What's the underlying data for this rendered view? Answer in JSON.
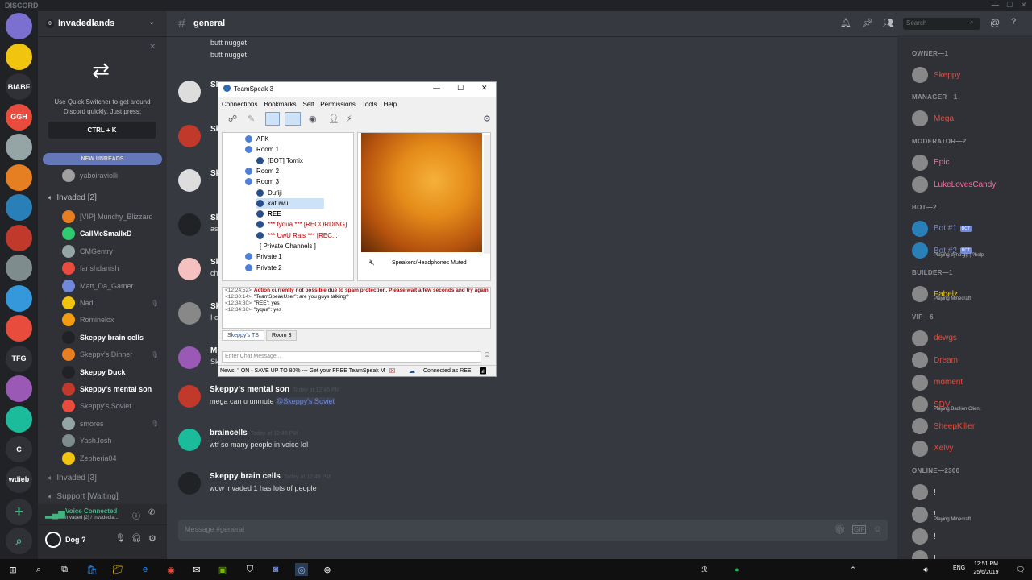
{
  "app_title": "DISCORD",
  "window_controls": [
    "—",
    "☐",
    "✕"
  ],
  "guilds": [
    {
      "label": "",
      "color": "#7b6fd0"
    },
    {
      "label": "",
      "color": "#f1c40f"
    },
    {
      "label": "BIABF",
      "color": "#2f3136"
    },
    {
      "label": "GGH",
      "color": "#e74c3c"
    },
    {
      "label": "",
      "color": "#95a5a6"
    },
    {
      "label": "",
      "color": "#e67e22"
    },
    {
      "label": "",
      "color": "#2980b9"
    },
    {
      "label": "",
      "color": "#c0392b"
    },
    {
      "label": "",
      "color": "#7f8c8d"
    },
    {
      "label": "",
      "color": "#3498db"
    },
    {
      "label": "",
      "color": "#e74c3c"
    },
    {
      "label": "TFG",
      "color": "#2f3136"
    },
    {
      "label": "",
      "color": "#9b59b6"
    },
    {
      "label": "",
      "color": "#1abc9c"
    },
    {
      "label": "C",
      "color": "#2f3136"
    },
    {
      "label": "wdieb",
      "color": "#2f3136"
    }
  ],
  "server": {
    "name": "Invadedlands",
    "badge": "0"
  },
  "quick_switcher": {
    "text": "Use Quick Switcher to get around Discord quickly. Just press:",
    "shortcut": "CTRL + K"
  },
  "new_unreads": "NEW UNREADS",
  "top_voice_user": "yaboiraviolli",
  "voice_channel_1": "Invaded [2]",
  "voice_users": [
    {
      "name": "[VIP] Munchy_Blizzard",
      "color": "#e67e22",
      "muted": false,
      "bold": false
    },
    {
      "name": "CallMeSmallxD",
      "color": "#2ecc71",
      "muted": false,
      "bold": true
    },
    {
      "name": "CMGentry",
      "color": "#95a5a6",
      "muted": false,
      "bold": false
    },
    {
      "name": "farishdanish",
      "color": "#e74c3c",
      "muted": false,
      "bold": false
    },
    {
      "name": "Matt_Da_Gamer",
      "color": "#7289da",
      "muted": false,
      "bold": false
    },
    {
      "name": "Nadi",
      "color": "#f1c40f",
      "muted": true,
      "bold": false
    },
    {
      "name": "Rominelox",
      "color": "#f39c12",
      "muted": false,
      "bold": false
    },
    {
      "name": "Skeppy brain cells",
      "color": "#202225",
      "muted": false,
      "bold": true
    },
    {
      "name": "Skeppy's Dinner",
      "color": "#e67e22",
      "muted": true,
      "bold": false
    },
    {
      "name": "Skeppy Duck",
      "color": "#202225",
      "muted": false,
      "bold": true
    },
    {
      "name": "Skeppy's mental son",
      "color": "#c0392b",
      "muted": false,
      "bold": true
    },
    {
      "name": "Skeppy's Soviet",
      "color": "#e74c3c",
      "muted": false,
      "bold": false
    },
    {
      "name": "smores",
      "color": "#95a5a6",
      "muted": true,
      "bold": false
    },
    {
      "name": "Yash.Iosh",
      "color": "#7f8c8d",
      "muted": false,
      "bold": false
    },
    {
      "name": "Zepheria04",
      "color": "#f1c40f",
      "muted": false,
      "bold": false
    }
  ],
  "voice_channel_2": "Invaded [3]",
  "voice_channel_3": "Support [Waiting]",
  "voice_connected": {
    "title": "Voice Connected",
    "sub": "Invaded [2] / Invadedla..."
  },
  "user": {
    "name": "Dog ?"
  },
  "channel": {
    "name": "general",
    "search_placeholder": "Search"
  },
  "early_messages": [
    "butt nugget",
    "butt nugget"
  ],
  "messages": [
    {
      "user": "Skeppy's mental son",
      "time": "Today at 12:45 PM",
      "text": "mega can u unmute ",
      "mention": "@Skeppy's Soviet",
      "color": "#c0392b"
    },
    {
      "user": "braincells",
      "time": "Today at 12:45 PM",
      "text": "wtf so many people in voice lol",
      "mention": "",
      "color": "#1abc9c"
    },
    {
      "user": "Skeppy brain cells",
      "time": "Today at 12:49 PM",
      "text": "wow invaded 1 has lots of people",
      "mention": "",
      "color": "#202225"
    }
  ],
  "partial_messages": [
    {
      "user": "Sk",
      "text": ""
    },
    {
      "user": "Sk",
      "text": ""
    },
    {
      "user": "Sk",
      "text": ""
    },
    {
      "user": "Sk",
      "text": "as"
    },
    {
      "user": "Sk",
      "text": "ch"
    },
    {
      "user": "Sk",
      "text": "I c"
    },
    {
      "user": "M",
      "text": "Sk"
    }
  ],
  "message_input_placeholder": "Message #general",
  "members": {
    "categories": [
      {
        "title": "OWNER—1",
        "members": [
          {
            "name": "Skeppy",
            "color": "#e74c3c",
            "status": ""
          }
        ]
      },
      {
        "title": "MANAGER—1",
        "members": [
          {
            "name": "Mega",
            "color": "#e74c3c",
            "status": ""
          }
        ]
      },
      {
        "title": "MODERATOR—2",
        "members": [
          {
            "name": "Epic",
            "color": "#ff6b9d",
            "status": ""
          },
          {
            "name": "LukeLovesCandy",
            "color": "#ff6b9d",
            "status": ""
          }
        ]
      },
      {
        "title": "BOT—2",
        "members": [
          {
            "name": "Bot #1",
            "color": "#7289da",
            "status": "",
            "bot": "BOT"
          },
          {
            "name": "Bot #2",
            "color": "#7289da",
            "status": "Playing dyno.gg | ?help",
            "bot": "BOT"
          }
        ]
      },
      {
        "title": "BUILDER—1",
        "members": [
          {
            "name": "Fabelz",
            "color": "#f1c40f",
            "status": "Playing Minecraft"
          }
        ]
      },
      {
        "title": "VIP—6",
        "members": [
          {
            "name": "dewgs",
            "color": "#e74c3c",
            "status": ""
          },
          {
            "name": "Dream",
            "color": "#e74c3c",
            "status": ""
          },
          {
            "name": "moment",
            "color": "#e74c3c",
            "status": ""
          },
          {
            "name": "SDV",
            "color": "#e74c3c",
            "status": "Playing Badlion Client"
          },
          {
            "name": "SheepKiller",
            "color": "#e74c3c",
            "status": ""
          },
          {
            "name": "Xelvy",
            "color": "#e74c3c",
            "status": ""
          }
        ]
      },
      {
        "title": "ONLINE—2300",
        "members": [
          {
            "name": "!",
            "color": "#dcddde",
            "status": ""
          },
          {
            "name": "!",
            "color": "#dcddde",
            "status": "Playing Minecraft"
          },
          {
            "name": "!",
            "color": "#dcddde",
            "status": ""
          },
          {
            "name": "!",
            "color": "#dcddde",
            "status": ""
          }
        ]
      }
    ]
  },
  "teamspeak": {
    "title": "TeamSpeak 3",
    "menu": [
      "Connections",
      "Bookmarks",
      "Self",
      "Permissions",
      "Tools",
      "Help"
    ],
    "tree": [
      {
        "label": "AFK",
        "kind": "channel",
        "indent": 0,
        "color": "#000"
      },
      {
        "label": "Room 1",
        "kind": "channel",
        "indent": 0,
        "color": "#000"
      },
      {
        "label": "[BOT] Tomix",
        "kind": "user",
        "indent": 1,
        "color": "#000"
      },
      {
        "label": "Room 2",
        "kind": "channel",
        "indent": 0,
        "color": "#000"
      },
      {
        "label": "Room 3",
        "kind": "channel",
        "indent": 0,
        "color": "#000"
      },
      {
        "label": "Dufiji",
        "kind": "user",
        "indent": 1,
        "color": "#000"
      },
      {
        "label": "katuwu",
        "kind": "user",
        "indent": 1,
        "color": "#000"
      },
      {
        "label": "REE",
        "kind": "user",
        "indent": 1,
        "color": "#000"
      },
      {
        "label": "*** tyqua *** [RECORDING]",
        "kind": "user",
        "indent": 1,
        "color": "#b00000"
      },
      {
        "label": "*** UwU Rais *** [REC...",
        "kind": "user",
        "indent": 1,
        "color": "#b00000"
      },
      {
        "label": "[ Private Channels ]",
        "kind": "spacer",
        "indent": 0,
        "color": "#000"
      },
      {
        "label": "Private 1",
        "kind": "channel",
        "indent": 0,
        "color": "#000"
      },
      {
        "label": "Private 2",
        "kind": "channel",
        "indent": 0,
        "color": "#000"
      }
    ],
    "audio_status": "Speakers/Headphones Muted",
    "log": [
      {
        "time": "<12:24:52>",
        "text": "Action currently not possible due to spam protection. Please wait a few seconds and try again.",
        "color": "#b00000"
      },
      {
        "time": "<12:30:14>",
        "text": "\"TeamSpeakUser\": are you guys talking?",
        "color": "#000"
      },
      {
        "time": "<12:34:30>",
        "text": "\"REE\": yes",
        "color": "#000"
      },
      {
        "time": "<12:34:36>",
        "text": "\"tyqua\": yes",
        "color": "#000"
      }
    ],
    "tabs": [
      "Skeppy's TS",
      "Room 3"
    ],
    "chat_placeholder": "Enter Chat Message...",
    "news": "News: \" ON - SAVE UP TO 80% --- Get your FREE TeamSpeak M",
    "connected_as": "Connected as REE"
  },
  "taskbar": {
    "lang": "ENG",
    "time": "12:51 PM",
    "date": "25/6/2019"
  }
}
